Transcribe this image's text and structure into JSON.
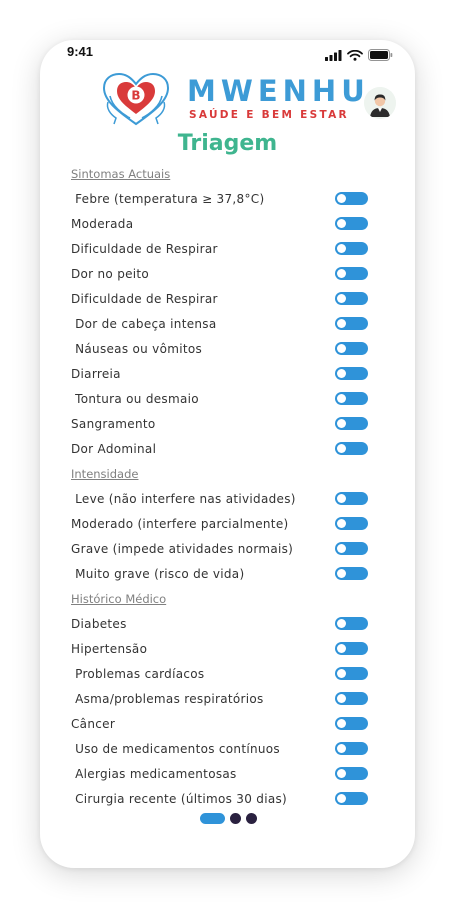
{
  "status_bar": {
    "time": "9:41"
  },
  "brand": {
    "name": "MWENHU",
    "tagline": "SAÚDE E BEM ESTAR",
    "badge_letter": "B"
  },
  "title": "Triagem",
  "sections": [
    {
      "title": "Sintomas Actuais",
      "items": [
        {
          "label": " Febre (temperatura ≥ 37,8°C)"
        },
        {
          "label": "Moderada"
        },
        {
          "label": "Dificuldade de Respirar"
        },
        {
          "label": "Dor no peito"
        },
        {
          "label": "Dificuldade de Respirar"
        },
        {
          "label": " Dor de cabeça intensa"
        },
        {
          "label": " Náuseas ou vômitos"
        },
        {
          "label": "Diarreia"
        },
        {
          "label": " Tontura ou desmaio"
        },
        {
          "label": "Sangramento"
        },
        {
          "label": "Dor Adominal"
        }
      ]
    },
    {
      "title": "Intensidade",
      "items": [
        {
          "label": " Leve (não interfere nas atividades)"
        },
        {
          "label": "Moderado (interfere parcialmente)"
        },
        {
          "label": "Grave (impede atividades normais)"
        },
        {
          "label": " Muito grave (risco de vida)"
        }
      ]
    },
    {
      "title": "Histórico Médico",
      "items": [
        {
          "label": "Diabetes"
        },
        {
          "label": "Hipertensão"
        },
        {
          "label": " Problemas cardíacos"
        },
        {
          "label": " Asma/problemas respiratórios"
        },
        {
          "label": "Câncer"
        },
        {
          "label": " Uso de medicamentos contínuos"
        },
        {
          "label": " Alergias medicamentosas"
        },
        {
          "label": " Cirurgia recente (últimos 30 dias)"
        }
      ]
    }
  ],
  "pager": {
    "pages": 3,
    "current": 1
  },
  "icons": {
    "signal": "signal-icon",
    "wifi": "wifi-icon",
    "battery": "battery-icon",
    "logo": "heart-faces-logo-icon",
    "avatar": "user-avatar-icon"
  },
  "colors": {
    "brand_blue": "#3d9bd6",
    "brand_red": "#d93a3a",
    "title_green": "#3fb58f",
    "toggle": "#2f93d9",
    "pager_dark": "#2a2140"
  }
}
